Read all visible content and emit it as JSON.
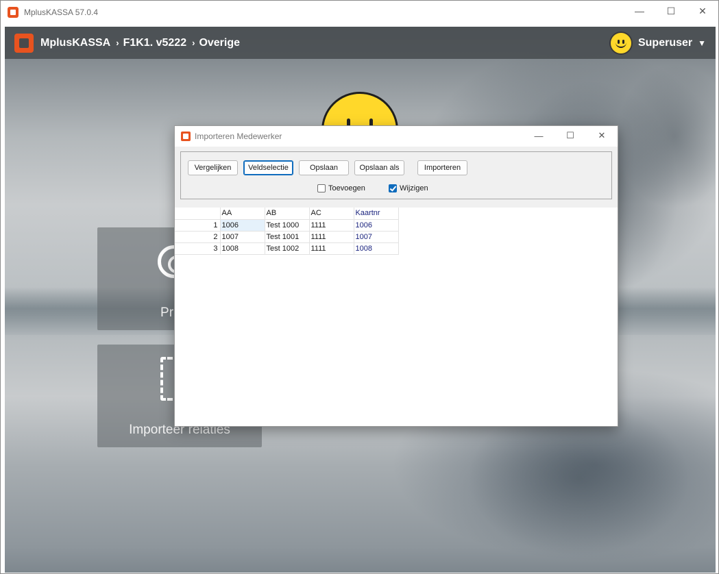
{
  "app": {
    "window_title": "MplusKASSA 57.0.4",
    "window_controls": {
      "minimize": "—",
      "maximize": "☐",
      "close": "✕"
    }
  },
  "header": {
    "breadcrumb": [
      "MplusKASSA",
      "F1K1. v5222",
      "Overige"
    ],
    "separator": "›",
    "user": "Superuser",
    "user_menu_icon": "chevron-down-icon"
  },
  "tiles": [
    {
      "label": "Printer",
      "icon": "gear-icon"
    },
    {
      "label": "Importeer relaties",
      "icon": "document-icon"
    }
  ],
  "dialog": {
    "title": "Importeren Medewerker",
    "window_controls": {
      "minimize": "—",
      "maximize": "☐",
      "close": "✕"
    },
    "buttons": {
      "vergelijken": "Vergelijken",
      "veldselectie": "Veldselectie",
      "opslaan": "Opslaan",
      "opslaan_als": "Opslaan als",
      "importeren": "Importeren"
    },
    "checkboxes": {
      "toevoegen": {
        "label": "Toevoegen",
        "checked": false
      },
      "wijzigen": {
        "label": "Wijzigen",
        "checked": true
      }
    },
    "grid": {
      "columns": [
        "AA",
        "AB",
        "AC",
        "Kaartnr"
      ],
      "rows": [
        {
          "num": "1",
          "aa": "1006",
          "ab": "Test 1000",
          "ac": "1111",
          "kaartnr": "1006"
        },
        {
          "num": "2",
          "aa": "1007",
          "ab": "Test 1001",
          "ac": "1111",
          "kaartnr": "1007"
        },
        {
          "num": "3",
          "aa": "1008",
          "ab": "Test 1002",
          "ac": "1111",
          "kaartnr": "1008"
        }
      ]
    }
  },
  "colors": {
    "brand": "#e8531f",
    "accent": "#0f6cbd",
    "kaartnr_text": "#1a237e"
  }
}
